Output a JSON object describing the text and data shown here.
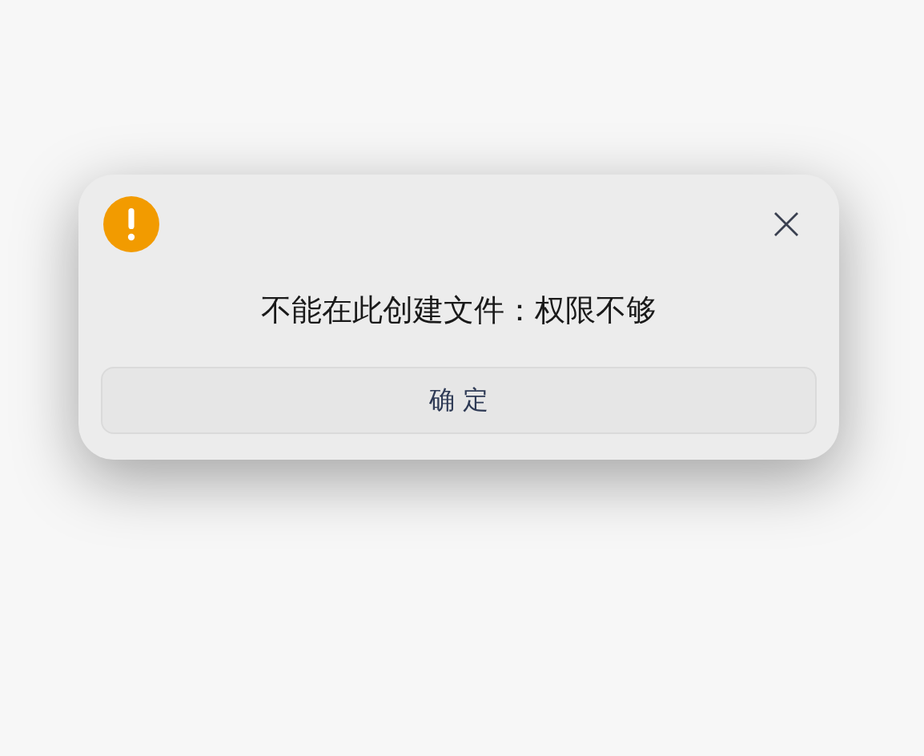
{
  "dialog": {
    "message": "不能在此创建文件：权限不够",
    "buttons": [
      {
        "label": "确 定"
      }
    ]
  }
}
